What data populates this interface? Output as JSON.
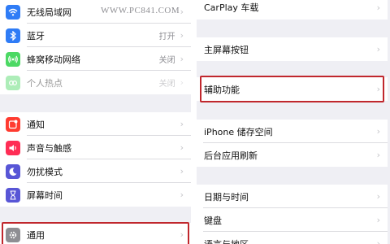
{
  "watermark": "WWW.PC841.COM",
  "colors": {
    "highlight": "#c0272d",
    "group_background": "#efeff4"
  },
  "left": {
    "items": [
      {
        "label": "无线局域网",
        "value": "",
        "icon": "wifi-icon",
        "icon_color": "#2f7cf6"
      },
      {
        "label": "蓝牙",
        "value": "打开",
        "icon": "bluetooth-icon",
        "icon_color": "#2f7cf6"
      },
      {
        "label": "蜂窝移动网络",
        "value": "关闭",
        "icon": "cellular-icon",
        "icon_color": "#4cd964"
      },
      {
        "label": "个人热点",
        "value": "关闭",
        "icon": "hotspot-icon",
        "icon_color": "#4cd964",
        "disabled": true
      },
      {
        "label": "通知",
        "value": "",
        "icon": "notifications-icon",
        "icon_color": "#ff3b30"
      },
      {
        "label": "声音与触感",
        "value": "",
        "icon": "sound-icon",
        "icon_color": "#ff2d55"
      },
      {
        "label": "勿扰模式",
        "value": "",
        "icon": "moon-icon",
        "icon_color": "#5856d6"
      },
      {
        "label": "屏幕时间",
        "value": "",
        "icon": "hourglass-icon",
        "icon_color": "#5856d6"
      },
      {
        "label": "通用",
        "value": "",
        "icon": "gear-icon",
        "icon_color": "#8e8e93",
        "highlighted": true
      }
    ]
  },
  "right": {
    "items": [
      {
        "label": "CarPlay 车载"
      },
      {
        "label": "主屏幕按钮"
      },
      {
        "label": "辅助功能",
        "highlighted": true
      },
      {
        "label": "iPhone 储存空间"
      },
      {
        "label": "后台应用刷新"
      },
      {
        "label": "日期与时间"
      },
      {
        "label": "键盘"
      },
      {
        "label": "语言与地区"
      }
    ]
  }
}
